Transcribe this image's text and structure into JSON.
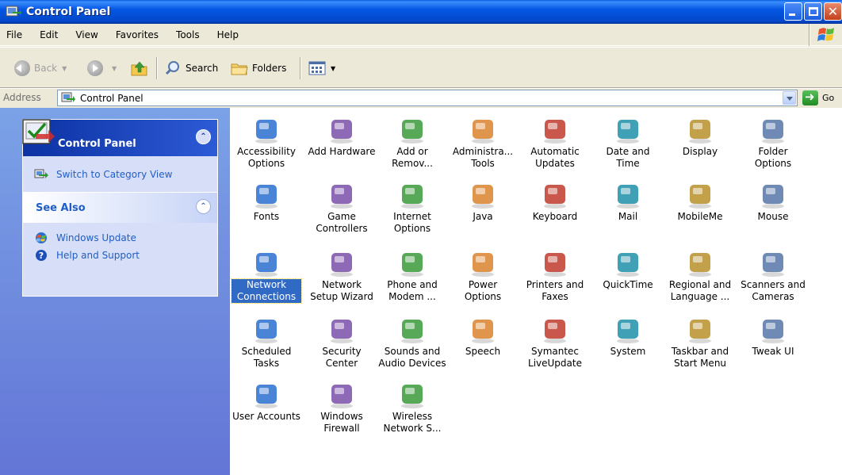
{
  "window": {
    "title": "Control Panel",
    "close_glyph": "✕"
  },
  "menu": [
    "File",
    "Edit",
    "View",
    "Favorites",
    "Tools",
    "Help"
  ],
  "toolbar": {
    "back": "Back",
    "search": "Search",
    "folders": "Folders",
    "dropdown_glyph": "▼"
  },
  "address": {
    "label": "Address",
    "value": "Control Panel",
    "go": "Go"
  },
  "left_pane": {
    "control_panel_title": "Control Panel",
    "collapse_glyph": "⌃",
    "switch_view": "Switch to Category View",
    "see_also_title": "See Also",
    "see_also": [
      "Windows Update",
      "Help and Support"
    ]
  },
  "items": [
    {
      "label": "Accessibility Options",
      "icon": "accessibility-icon"
    },
    {
      "label": "Add Hardware",
      "icon": "add-hardware-icon"
    },
    {
      "label": "Add or Remov...",
      "icon": "add-remove-programs-icon"
    },
    {
      "label": "Administra... Tools",
      "icon": "administrative-tools-icon"
    },
    {
      "label": "Automatic Updates",
      "icon": "automatic-updates-icon"
    },
    {
      "label": "Date and Time",
      "icon": "date-time-icon"
    },
    {
      "label": "Display",
      "icon": "display-icon"
    },
    {
      "label": "Folder Options",
      "icon": "folder-options-icon"
    },
    {
      "label": "Fonts",
      "icon": "fonts-icon"
    },
    {
      "label": "Game Controllers",
      "icon": "game-controllers-icon"
    },
    {
      "label": "Internet Options",
      "icon": "internet-options-icon"
    },
    {
      "label": "Java",
      "icon": "java-icon"
    },
    {
      "label": "Keyboard",
      "icon": "keyboard-icon"
    },
    {
      "label": "Mail",
      "icon": "mail-icon"
    },
    {
      "label": "MobileMe",
      "icon": "mobileme-icon"
    },
    {
      "label": "Mouse",
      "icon": "mouse-icon"
    },
    {
      "label": "Network Connections",
      "icon": "network-connections-icon",
      "selected": true
    },
    {
      "label": "Network Setup Wizard",
      "icon": "network-setup-wizard-icon"
    },
    {
      "label": "Phone and Modem ...",
      "icon": "phone-modem-icon"
    },
    {
      "label": "Power Options",
      "icon": "power-options-icon"
    },
    {
      "label": "Printers and Faxes",
      "icon": "printers-faxes-icon"
    },
    {
      "label": "QuickTime",
      "icon": "quicktime-icon"
    },
    {
      "label": "Regional and Language ...",
      "icon": "regional-language-icon"
    },
    {
      "label": "Scanners and Cameras",
      "icon": "scanners-cameras-icon"
    },
    {
      "label": "Scheduled Tasks",
      "icon": "scheduled-tasks-icon"
    },
    {
      "label": "Security Center",
      "icon": "security-center-icon"
    },
    {
      "label": "Sounds and Audio Devices",
      "icon": "sounds-audio-icon"
    },
    {
      "label": "Speech",
      "icon": "speech-icon"
    },
    {
      "label": "Symantec LiveUpdate",
      "icon": "symantec-liveupdate-icon"
    },
    {
      "label": "System",
      "icon": "system-icon"
    },
    {
      "label": "Taskbar and Start Menu",
      "icon": "taskbar-start-menu-icon"
    },
    {
      "label": "Tweak UI",
      "icon": "tweak-ui-icon"
    },
    {
      "label": "User Accounts",
      "icon": "user-accounts-icon"
    },
    {
      "label": "Windows Firewall",
      "icon": "windows-firewall-icon"
    },
    {
      "label": "Wireless Network S...",
      "icon": "wireless-network-icon"
    }
  ]
}
